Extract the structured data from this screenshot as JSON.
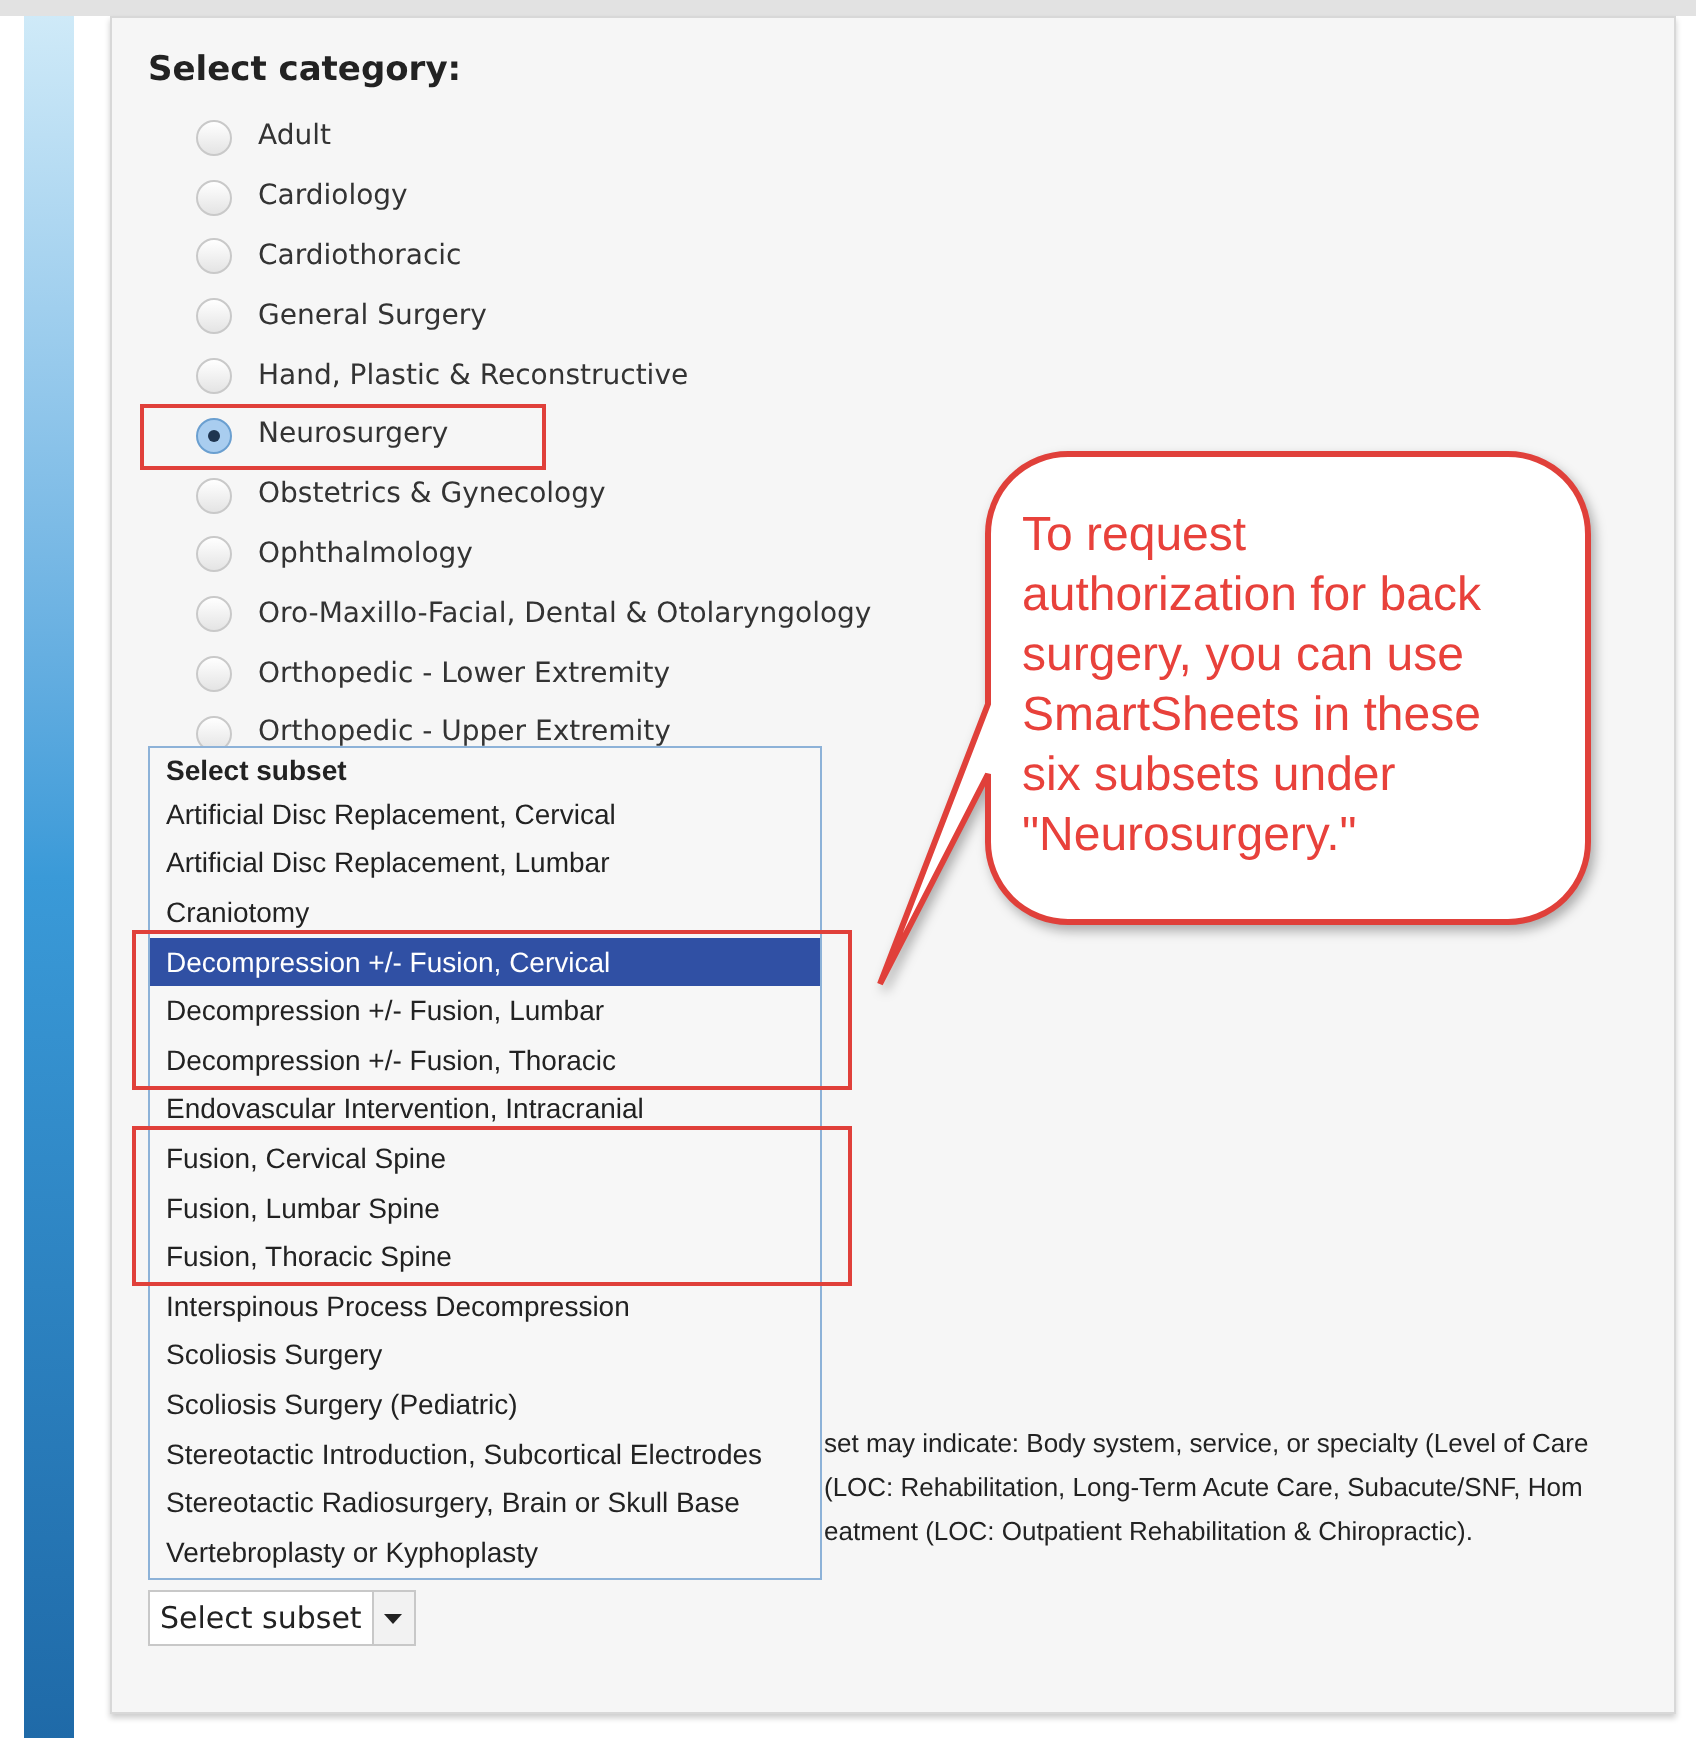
{
  "category": {
    "title": "Select category:",
    "options": [
      {
        "label": "Adult",
        "selected": false,
        "highlighted": false
      },
      {
        "label": "Cardiology",
        "selected": false,
        "highlighted": false
      },
      {
        "label": "Cardiothoracic",
        "selected": false,
        "highlighted": false
      },
      {
        "label": "General Surgery",
        "selected": false,
        "highlighted": false
      },
      {
        "label": "Hand, Plastic & Reconstructive",
        "selected": false,
        "highlighted": false
      },
      {
        "label": "Neurosurgery",
        "selected": true,
        "highlighted": true
      },
      {
        "label": "Obstetrics & Gynecology",
        "selected": false,
        "highlighted": false
      },
      {
        "label": "Ophthalmology",
        "selected": false,
        "highlighted": false
      },
      {
        "label": "Oro-Maxillo-Facial, Dental & Otolaryngology",
        "selected": false,
        "highlighted": false
      },
      {
        "label": "Orthopedic - Lower Extremity",
        "selected": false,
        "highlighted": false
      },
      {
        "label": "Orthopedic - Upper Extremity",
        "selected": false,
        "highlighted": false
      }
    ]
  },
  "subset_list": {
    "header": "Select subset",
    "items": [
      {
        "label": "Artificial Disc Replacement, Cervical",
        "selected": false,
        "highlighted": false
      },
      {
        "label": "Artificial Disc Replacement, Lumbar",
        "selected": false,
        "highlighted": false
      },
      {
        "label": "Craniotomy",
        "selected": false,
        "highlighted": false
      },
      {
        "label": "Decompression +/- Fusion, Cervical",
        "selected": true,
        "highlighted": true
      },
      {
        "label": "Decompression +/- Fusion, Lumbar",
        "selected": false,
        "highlighted": true
      },
      {
        "label": "Decompression +/- Fusion, Thoracic",
        "selected": false,
        "highlighted": true
      },
      {
        "label": "Endovascular Intervention, Intracranial",
        "selected": false,
        "highlighted": false
      },
      {
        "label": "Fusion, Cervical Spine",
        "selected": false,
        "highlighted": true
      },
      {
        "label": "Fusion, Lumbar Spine",
        "selected": false,
        "highlighted": true
      },
      {
        "label": "Fusion, Thoracic Spine",
        "selected": false,
        "highlighted": true
      },
      {
        "label": "Interspinous Process Decompression",
        "selected": false,
        "highlighted": false
      },
      {
        "label": "Scoliosis Surgery",
        "selected": false,
        "highlighted": false
      },
      {
        "label": "Scoliosis Surgery (Pediatric)",
        "selected": false,
        "highlighted": false
      },
      {
        "label": "Stereotactic Introduction, Subcortical Electrodes",
        "selected": false,
        "highlighted": false
      },
      {
        "label": "Stereotactic Radiosurgery, Brain or Skull Base",
        "selected": false,
        "highlighted": false
      },
      {
        "label": "Vertebroplasty or Kyphoplasty",
        "selected": false,
        "highlighted": false
      }
    ]
  },
  "description_lines": [
    "set may indicate: Body system, service, or specialty (Level of Care",
    "(LOC: Rehabilitation, Long-Term Acute Care, Subacute/SNF, Hom",
    "eatment (LOC: Outpatient Rehabilitation & Chiropractic)."
  ],
  "subset_select": {
    "value": "Select subset"
  },
  "callout": {
    "text": "To request authorization for back surgery, you can use SmartSheets in these six subsets under \"Neurosurgery.\""
  }
}
